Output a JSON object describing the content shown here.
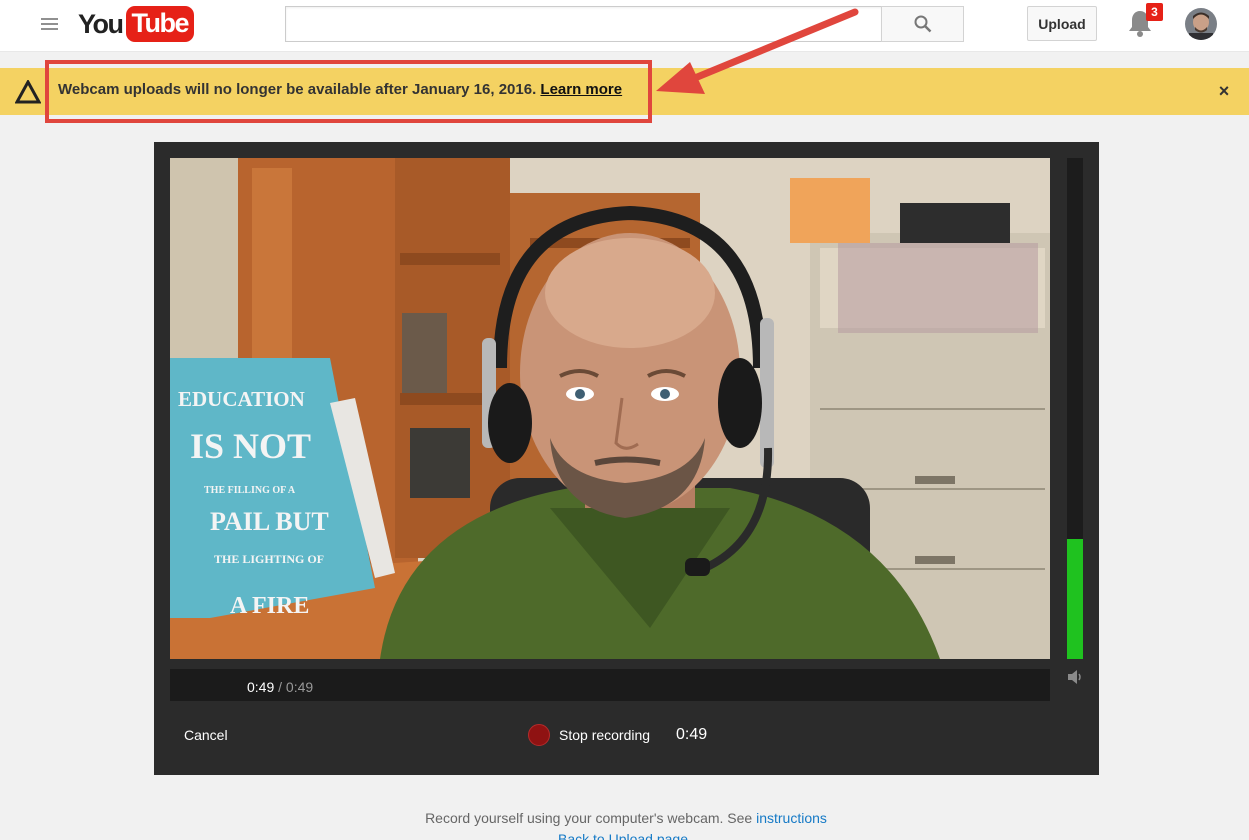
{
  "header": {
    "logo_you": "You",
    "logo_tube": "Tube",
    "search": {
      "value": "",
      "placeholder": ""
    },
    "upload_label": "Upload",
    "notification_count": "3",
    "icons": {
      "menu": "hamburger-menu-icon",
      "search": "search-icon",
      "notifications": "bell-icon",
      "avatar": "user-avatar"
    }
  },
  "alert": {
    "message": "Webcam uploads will no longer be available after January 16, 2016.",
    "link_label": "Learn more",
    "close_label": "×",
    "icons": {
      "warning": "warning-triangle-icon"
    },
    "colors": {
      "background": "#f4d262",
      "highlight_border": "#e0463d"
    }
  },
  "recorder": {
    "current_time": "0:49",
    "time_separator": "/",
    "total_time": "0:49",
    "cancel_label": "Cancel",
    "stop_label": "Stop recording",
    "elapsed": "0:49",
    "audio_level": 0.24,
    "icons": {
      "volume": "speaker-icon",
      "record": "record-dot-icon"
    },
    "colors": {
      "meter": "#1fc21f",
      "record": "#8f1212"
    },
    "book_text": [
      "EDUCATION",
      "IS NOT",
      "THE FILLING OF A",
      "PAIL BUT",
      "THE LIGHTING OF",
      "A FIRE"
    ]
  },
  "footer": {
    "text": "Record yourself using your computer's webcam. See",
    "instructions_link": "instructions",
    "back_link": "Back to Upload page"
  }
}
